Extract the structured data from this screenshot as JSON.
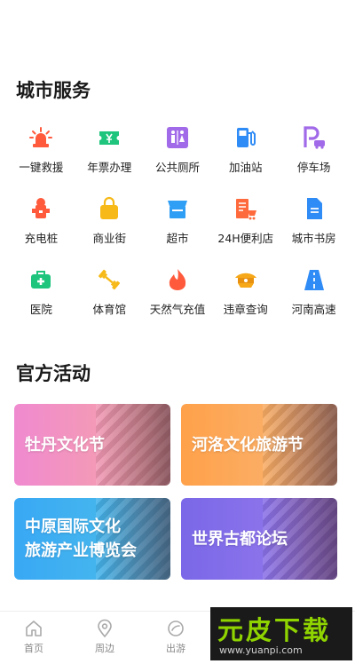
{
  "sections": {
    "city_services_title": "城市服务",
    "activities_title": "官方活动"
  },
  "services": [
    {
      "label": "一键救援",
      "icon": "siren-icon",
      "color": "#ff5a3c"
    },
    {
      "label": "年票办理",
      "icon": "ticket-icon",
      "color": "#1fc47d"
    },
    {
      "label": "公共厕所",
      "icon": "restroom-icon",
      "color": "#a16ae8"
    },
    {
      "label": "加油站",
      "icon": "fuel-pump-icon",
      "color": "#2f8bf5"
    },
    {
      "label": "停车场",
      "icon": "parking-icon",
      "color": "#a16ae8"
    },
    {
      "label": "充电桩",
      "icon": "charging-pile-icon",
      "color": "#ff5a3c"
    },
    {
      "label": "商业街",
      "icon": "shopping-bag-icon",
      "color": "#f6b918"
    },
    {
      "label": "超市",
      "icon": "supermarket-icon",
      "color": "#2f9ff5"
    },
    {
      "label": "24H便利店",
      "icon": "convenience-store-icon",
      "color": "#ff6a3c"
    },
    {
      "label": "城市书房",
      "icon": "document-icon",
      "color": "#2f8bf5"
    },
    {
      "label": "医院",
      "icon": "hospital-icon",
      "color": "#1fc47d"
    },
    {
      "label": "体育馆",
      "icon": "dumbbell-icon",
      "color": "#f6b918"
    },
    {
      "label": "天然气充值",
      "icon": "flame-icon",
      "color": "#ff5a3c"
    },
    {
      "label": "违章查询",
      "icon": "police-cap-icon",
      "color": "#f6a818"
    },
    {
      "label": "河南高速",
      "icon": "highway-icon",
      "color": "#2f8bf5"
    }
  ],
  "activities": [
    {
      "lines": [
        "牡丹文化节"
      ],
      "from": "#f08ad0",
      "to": "#f7a7a0"
    },
    {
      "lines": [
        "河洛文化旅游节"
      ],
      "from": "#ffa14a",
      "to": "#f7b87a"
    },
    {
      "lines": [
        "中原国际文化",
        "旅游产业博览会"
      ],
      "from": "#39a8f5",
      "to": "#4ec0e8"
    },
    {
      "lines": [
        "世界古都论坛"
      ],
      "from": "#7a68e8",
      "to": "#9a7cec"
    }
  ],
  "tabbar": {
    "home": "首页",
    "nearby": "周边",
    "travel": "出游"
  },
  "watermark": {
    "big": "元皮下载",
    "small": "www.yuanpi.com"
  }
}
